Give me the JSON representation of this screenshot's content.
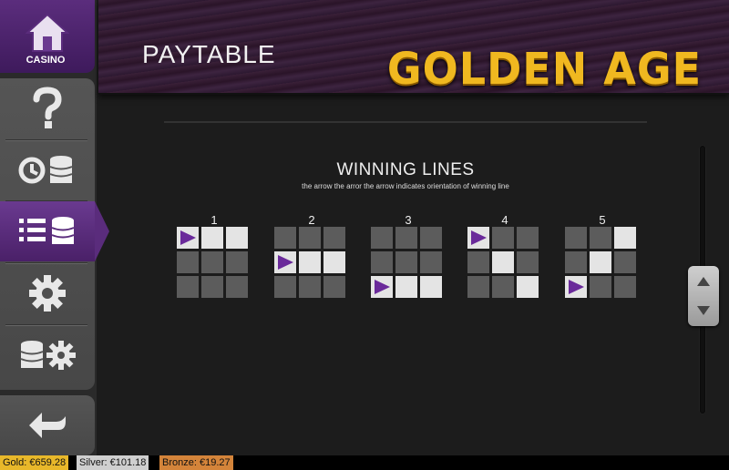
{
  "header": {
    "title": "PAYTABLE",
    "logo": "GOLDEN AGE"
  },
  "sidebar": {
    "casino_label": "CASINO",
    "items": [
      {
        "name": "help",
        "icon": "question-icon"
      },
      {
        "name": "history",
        "icon": "history-coins-icon"
      },
      {
        "name": "paytable",
        "icon": "list-coins-icon",
        "active": true
      },
      {
        "name": "settings",
        "icon": "gear-icon"
      },
      {
        "name": "bet-settings",
        "icon": "coins-gear-icon"
      },
      {
        "name": "back",
        "icon": "back-arrow-icon"
      }
    ]
  },
  "section": {
    "title": "WINNING LINES",
    "subtitle": "the arrow the arror the arrow indicates orientation of winning line"
  },
  "lines": [
    {
      "num": "1",
      "cells": [
        "A",
        "L",
        "L",
        "D",
        "D",
        "D",
        "D",
        "D",
        "D"
      ]
    },
    {
      "num": "2",
      "cells": [
        "D",
        "D",
        "D",
        "A",
        "L",
        "L",
        "D",
        "D",
        "D"
      ]
    },
    {
      "num": "3",
      "cells": [
        "D",
        "D",
        "D",
        "D",
        "D",
        "D",
        "A",
        "L",
        "L"
      ]
    },
    {
      "num": "4",
      "cells": [
        "A",
        "D",
        "D",
        "D",
        "L",
        "D",
        "D",
        "D",
        "L"
      ]
    },
    {
      "num": "5",
      "cells": [
        "D",
        "D",
        "L",
        "D",
        "L",
        "D",
        "A",
        "D",
        "D"
      ]
    }
  ],
  "balances": {
    "gold": "Gold: €659.28",
    "silver": "Silver: €101.18",
    "bronze": "Bronze: €19.27"
  },
  "colors": {
    "accent_purple": "#5b2d7d",
    "logo_gold": "#f0b820",
    "arrow": "#6a2a9a"
  }
}
